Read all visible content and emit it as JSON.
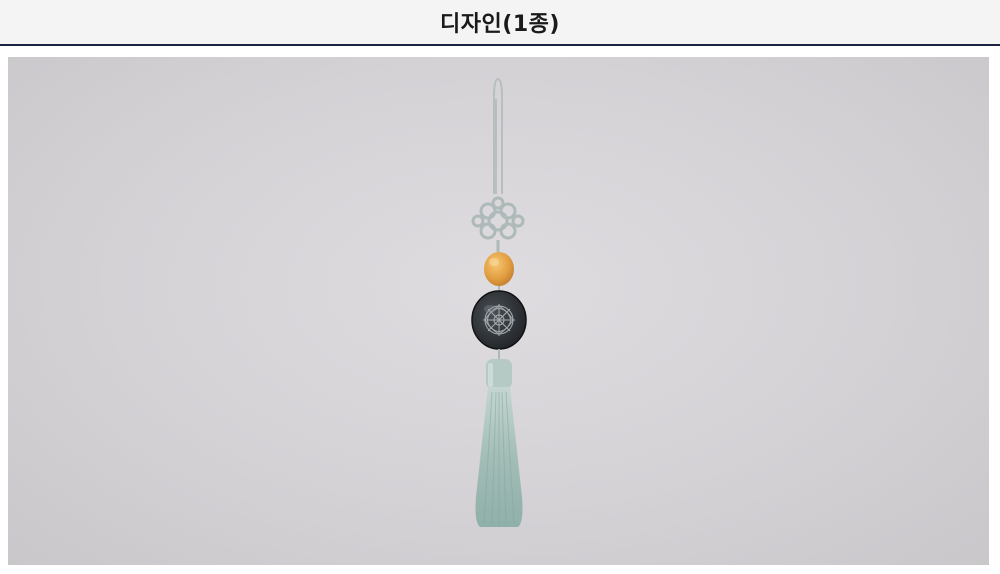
{
  "header": {
    "title": "디자인(1종)",
    "rule_color": "#1c2340"
  },
  "photo": {
    "subject_icon": "norigae-tassel-ornament",
    "colors": {
      "background": "#d6d4d7",
      "cord": "#b9c3c2",
      "bead": "#e6a44a",
      "medallion": "#2b2f33",
      "tassel": "#9fbab4"
    }
  }
}
